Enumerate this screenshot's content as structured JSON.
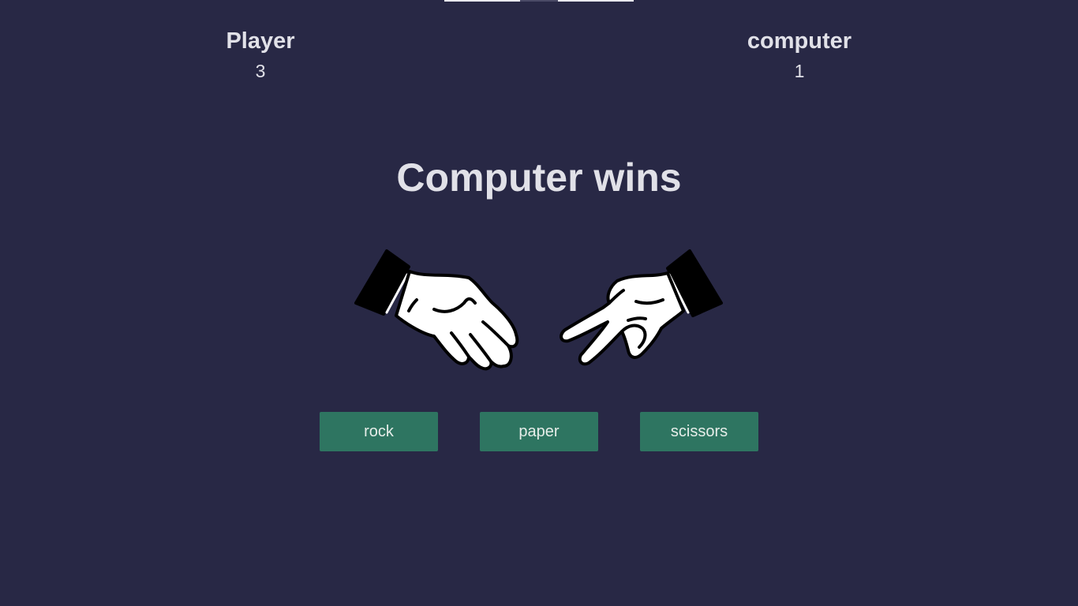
{
  "scoreboard": {
    "player": {
      "label": "Player",
      "score": "3"
    },
    "computer": {
      "label": "computer",
      "score": "1"
    }
  },
  "result": {
    "message": "Computer wins"
  },
  "hands": {
    "player_choice_icon": "paper-hand-icon",
    "computer_choice_icon": "scissors-hand-icon"
  },
  "choices": {
    "rock_label": "rock",
    "paper_label": "paper",
    "scissors_label": "scissors"
  },
  "colors": {
    "background": "#282845",
    "button": "#2e7561",
    "text": "#e1e1e8"
  }
}
